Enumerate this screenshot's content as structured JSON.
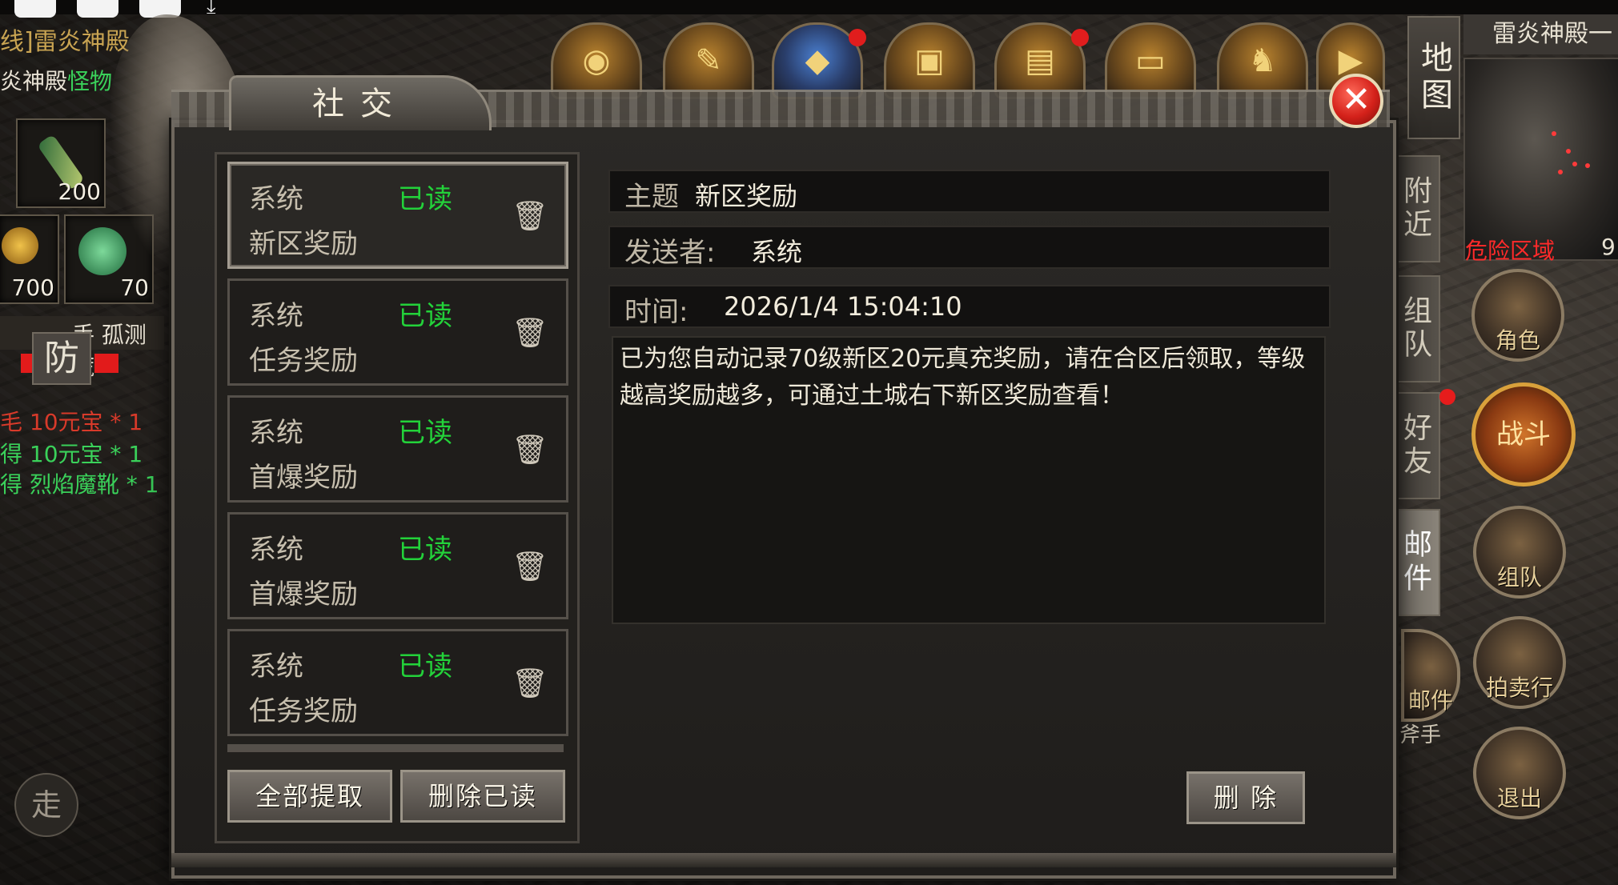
{
  "top_left": {
    "region_title": "线]雷炎神殿",
    "sub_prefix": "炎神殿",
    "sub_highlight": "怪物"
  },
  "slots": [
    {
      "count": "200"
    },
    {
      "count": "700"
    },
    {
      "count": "70"
    }
  ],
  "hud": {
    "def_label": "防",
    "player_name_fragment": "手 孤测谎",
    "walk_label": "走"
  },
  "chat_lines": [
    {
      "text": "毛 10元宝 * 1",
      "color": "#d83a2a"
    },
    {
      "text": "得 10元宝 * 1",
      "color": "#3ad15a"
    },
    {
      "text": "得 烈焰魔靴 * 1",
      "color": "#3ad15a"
    }
  ],
  "right": {
    "map_tab": "地图",
    "region_name": "雷炎神殿一",
    "danger_label": "危险区域",
    "coord_fragment": "9",
    "side_tabs": [
      {
        "label": "附近",
        "active": false
      },
      {
        "label": "组队",
        "active": false
      },
      {
        "label": "好友",
        "active": false
      },
      {
        "label": "邮件",
        "active": true
      }
    ],
    "round_buttons": [
      {
        "label": "角色"
      },
      {
        "label": "组队"
      },
      {
        "label": "拍卖行"
      },
      {
        "label": "退出"
      }
    ],
    "battle_label": "战斗",
    "axe_text": "斧手",
    "mail_fragment": "邮件"
  },
  "dialog": {
    "title": "社交",
    "close_symbol": "✕"
  },
  "mail_list": [
    {
      "sender": "系统",
      "status": "已读",
      "subject": "新区奖励",
      "selected": true
    },
    {
      "sender": "系统",
      "status": "已读",
      "subject": "任务奖励",
      "selected": false
    },
    {
      "sender": "系统",
      "status": "已读",
      "subject": "首爆奖励",
      "selected": false
    },
    {
      "sender": "系统",
      "status": "已读",
      "subject": "首爆奖励",
      "selected": false
    },
    {
      "sender": "系统",
      "status": "已读",
      "subject": "任务奖励",
      "selected": false
    }
  ],
  "list_buttons": {
    "claim_all": "全部提取",
    "delete_read": "删除已读"
  },
  "detail": {
    "subject_label": "主题",
    "subject_value": "新区奖励",
    "sender_label": "发送者:",
    "sender_value": "系统",
    "time_label": "时间:",
    "time_value": "2026/1/4 15:04:10",
    "body": "已为您自动记录70级新区20元真充奖励，请在合区后领取，等级越高奖励越多，可通过土城右下新区奖励查看！",
    "delete_button": "删 除"
  },
  "colors": {
    "read_status": "#23d23a",
    "close_red": "#d4211a",
    "danger_red": "#ff2a2a"
  }
}
